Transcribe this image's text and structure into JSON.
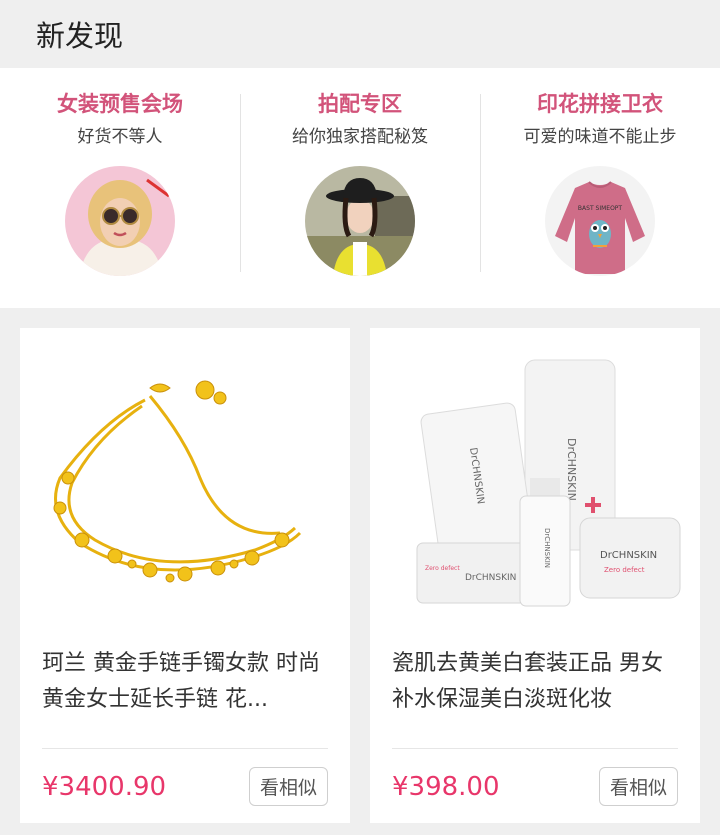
{
  "header": {
    "title": "新发现"
  },
  "discover": [
    {
      "title": "女装预售会场",
      "subtitle": "好货不等人",
      "image": "fashion-woman-sunglasses"
    },
    {
      "title": "拍配专区",
      "subtitle": "给你独家搭配秘笈",
      "image": "woman-black-hat-yellow-cardigan"
    },
    {
      "title": "印花拼接卫衣",
      "subtitle": "可爱的味道不能止步",
      "image": "pink-owl-sweatshirt"
    }
  ],
  "products": [
    {
      "title": "珂兰 黄金手链手镯女款 时尚黄金女士延长手链 花...",
      "price": "¥3400.90",
      "action": "看相似",
      "image": "gold-bracelet"
    },
    {
      "title": "瓷肌去黄美白套装正品 男女补水保湿美白淡斑化妆",
      "price": "¥398.00",
      "action": "看相似",
      "image": "skincare-set",
      "image_text": {
        "brand": "DrCHNSKIN",
        "tag": "Zero defect",
        "shirt": "BAST SIMEOPT"
      }
    }
  ],
  "colors": {
    "accent_pink": "#d2537a",
    "price_red": "#e8366a"
  }
}
